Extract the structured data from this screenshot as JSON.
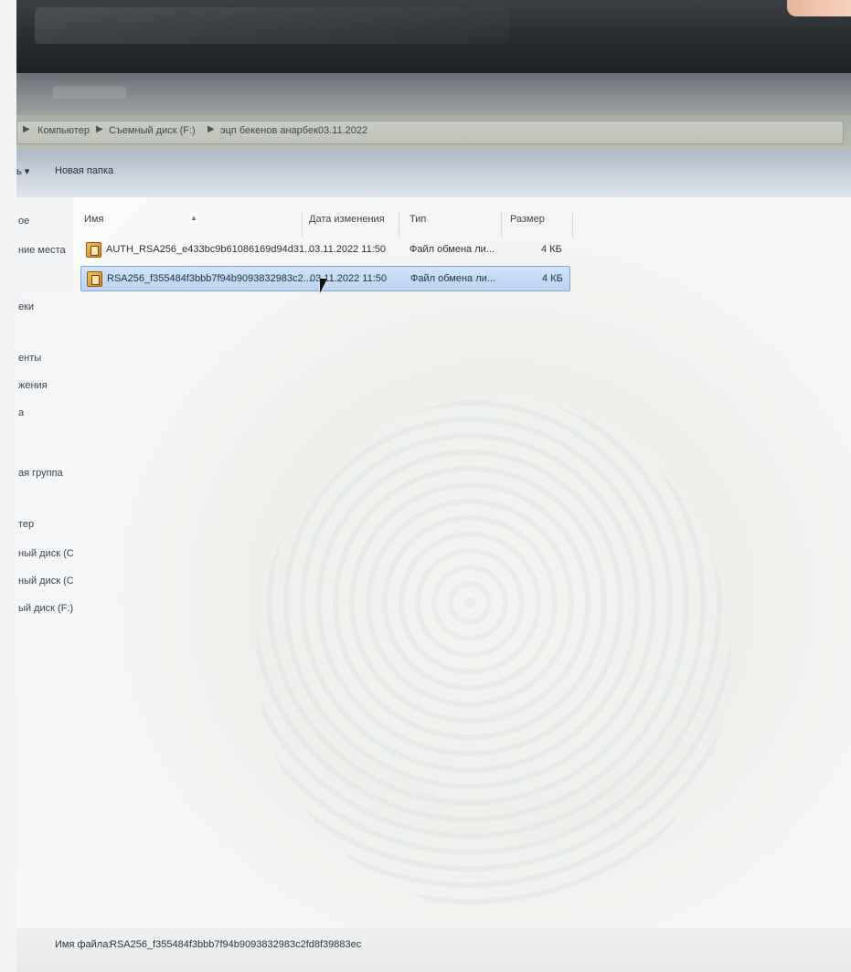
{
  "address": {
    "crumbs": [
      "Компьютер",
      "Съемный диск (F:)",
      "эцп бекенов анарбек03.11.2022"
    ]
  },
  "toolbar": {
    "organize_label": "ь ▾",
    "new_folder_label": "Новая папка"
  },
  "nav": {
    "items": [
      "ое",
      "ние места",
      "еки",
      "енты",
      "жения",
      "а",
      "ая группа",
      "тер",
      "ный диск (C",
      "ный диск (C",
      "ый диск (F:)"
    ]
  },
  "columns": {
    "name": "Имя",
    "date": "Дата изменения",
    "type": "Тип",
    "size": "Размер"
  },
  "files": [
    {
      "name": "AUTH_RSA256_e433bc9b61086169d94d31...",
      "date": "03.11.2022 11:50",
      "type": "Файл обмена ли...",
      "size": "4 КБ",
      "selected": false
    },
    {
      "name": "RSA256_f355484f3bbb7f94b9093832983c2...",
      "date": "03.11.2022 11:50",
      "type": "Файл обмена ли...",
      "size": "4 КБ",
      "selected": true
    }
  ],
  "filename_field": {
    "label": "Имя файла:",
    "value": "RSA256_f355484f3bbb7f94b9093832983c2fd8f39883ec"
  },
  "icons": {
    "file": "certificate-file-icon",
    "cursor": "mouse-pointer-icon",
    "sort": "sort-ascending-icon"
  },
  "colors": {
    "selection": "#b9d3f1",
    "selection_border": "#7ea7da",
    "toolbar": "#c4ccd8"
  }
}
